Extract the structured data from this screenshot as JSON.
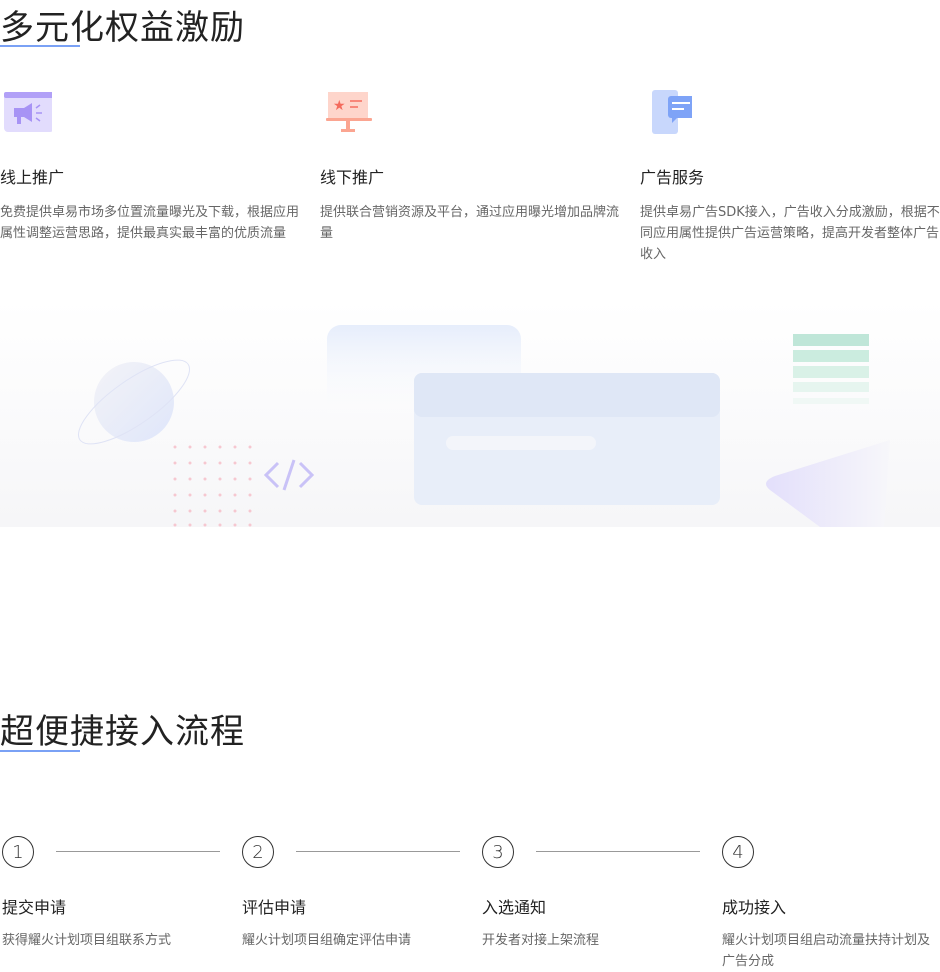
{
  "section1": {
    "title": "多元化权益激励",
    "cards": [
      {
        "icon": "megaphone-icon",
        "title": "线上推广",
        "desc": "免费提供卓易市场多位置流量曝光及下载，根据应用属性调整运营思路，提供最真实最丰富的优质流量"
      },
      {
        "icon": "billboard-star-icon",
        "title": "线下推广",
        "desc": "提供联合营销资源及平台，通过应用曝光增加品牌流量"
      },
      {
        "icon": "phone-message-icon",
        "title": "广告服务",
        "desc": "提供卓易广告SDK接入，广告收入分成激励，根据不同应用属性提供广告运营策略，提高开发者整体广告收入"
      }
    ]
  },
  "section2": {
    "title": "超便捷接入流程",
    "steps": [
      {
        "num": "1",
        "title": "提交申请",
        "desc": "获得耀火计划项目组联系方式"
      },
      {
        "num": "2",
        "title": "评估申请",
        "desc": "耀火计划项目组确定评估申请"
      },
      {
        "num": "3",
        "title": "入选通知",
        "desc": "开发者对接上架流程"
      },
      {
        "num": "4",
        "title": "成功接入",
        "desc": "耀火计划项目组启动流量扶持计划及广告分成"
      }
    ]
  },
  "colors": {
    "accent": "#7aa1f5",
    "purple": "#b1a0f7",
    "coral": "#fba591",
    "blue": "#7ea3f7"
  }
}
